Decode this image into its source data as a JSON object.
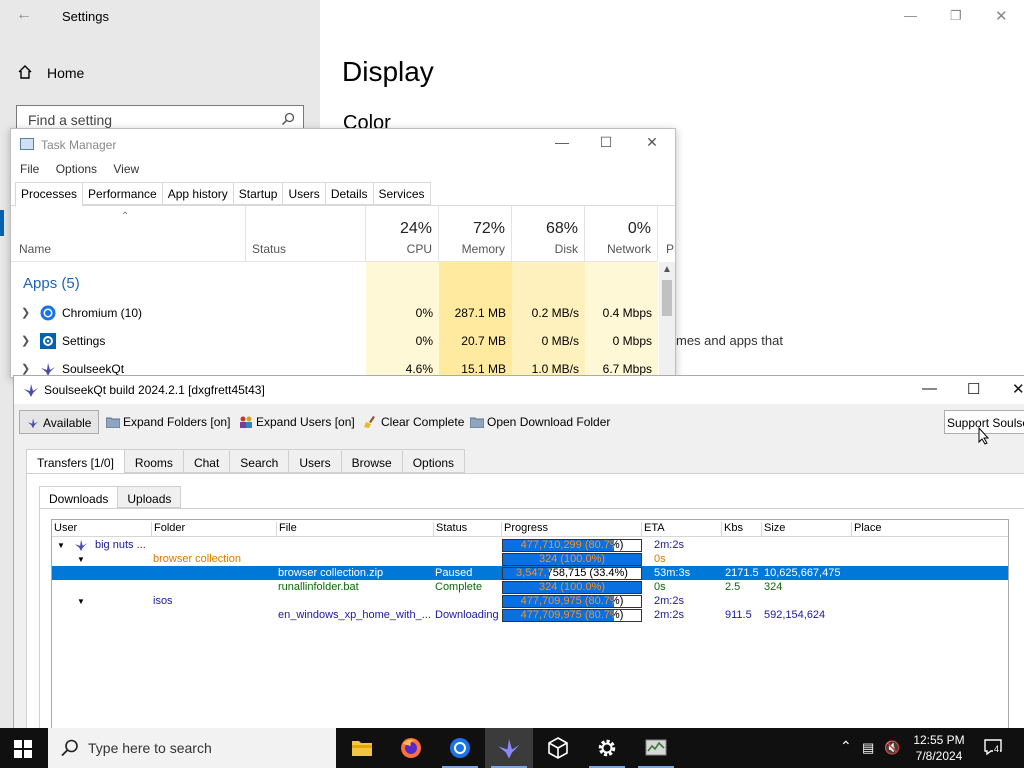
{
  "settings": {
    "title": "Settings",
    "home_label": "Home",
    "search_placeholder": "Find a setting",
    "page_title": "Display",
    "section_title": "Color",
    "snippet_text": "mes and apps that"
  },
  "task_manager": {
    "title": "Task Manager",
    "menu": [
      "File",
      "Options",
      "View"
    ],
    "tabs": [
      "Processes",
      "Performance",
      "App history",
      "Startup",
      "Users",
      "Details",
      "Services"
    ],
    "active_tab": "Processes",
    "columns": {
      "name": "Name",
      "status": "Status",
      "cpu": {
        "pct": "24%",
        "label": "CPU"
      },
      "memory": {
        "pct": "72%",
        "label": "Memory"
      },
      "disk": {
        "pct": "68%",
        "label": "Disk"
      },
      "network": {
        "pct": "0%",
        "label": "Network"
      },
      "power_partial": "P"
    },
    "group_label": "Apps (5)",
    "rows": [
      {
        "name": "Chromium (10)",
        "cpu": "0%",
        "memory": "287.1 MB",
        "disk": "0.2 MB/s",
        "network": "0.4 Mbps"
      },
      {
        "name": "Settings",
        "cpu": "0%",
        "memory": "20.7 MB",
        "disk": "0 MB/s",
        "network": "0 Mbps"
      },
      {
        "name": "SoulseekQt",
        "cpu": "4.6%",
        "memory": "15.1 MB",
        "disk": "1.0 MB/s",
        "network": "6.7 Mbps"
      }
    ]
  },
  "soulseek": {
    "title": "SoulseekQt build 2024.2.1 [dxgfrett45t43]",
    "toolbar": {
      "available": "Available",
      "expand_folders": "Expand Folders [on]",
      "expand_users": "Expand Users [on]",
      "clear_complete": "Clear Complete",
      "open_download_folder": "Open Download Folder",
      "support": "Support Soulseek"
    },
    "main_tabs": [
      "Transfers [1/0]",
      "Rooms",
      "Chat",
      "Search",
      "Users",
      "Browse",
      "Options"
    ],
    "sub_tabs": [
      "Downloads",
      "Uploads"
    ],
    "columns": [
      "User",
      "Folder",
      "File",
      "Status",
      "Progress",
      "ETA",
      "Kbs",
      "Size",
      "Place"
    ],
    "rows": [
      {
        "kind": "user",
        "user": "big nuts ...",
        "folder": "",
        "file": "",
        "status": "",
        "progress": "477,710,299 (80.7%)",
        "fraction": 0.807,
        "eta": "2m:2s",
        "kbs": "",
        "size": "",
        "color": "blue"
      },
      {
        "kind": "folder",
        "user": "",
        "folder": "browser collection",
        "file": "",
        "status": "",
        "progress": "324 (100.0%)",
        "fraction": 1.0,
        "eta": "0s",
        "kbs": "",
        "size": "",
        "color": "orange"
      },
      {
        "kind": "file",
        "user": "",
        "folder": "",
        "file": "browser collection.zip",
        "status": "Paused",
        "progress": "3,547,758,715 (33.4%)",
        "fraction": 0.334,
        "eta": "53m:3s",
        "kbs": "2171.5",
        "size": "10,625,667,475",
        "color": "selected"
      },
      {
        "kind": "file",
        "user": "",
        "folder": "",
        "file": "runallinfolder.bat",
        "status": "Complete",
        "progress": "324 (100.0%)",
        "fraction": 1.0,
        "eta": "0s",
        "kbs": "2.5",
        "size": "324",
        "color": "green"
      },
      {
        "kind": "folder",
        "user": "",
        "folder": "isos",
        "file": "",
        "status": "",
        "progress": "477,709,975 (80.7%)",
        "fraction": 0.807,
        "eta": "2m:2s",
        "kbs": "",
        "size": "",
        "color": "blue"
      },
      {
        "kind": "file",
        "user": "",
        "folder": "",
        "file": "en_windows_xp_home_with_...",
        "status": "Downloading",
        "progress": "477,709,975 (80.7%)",
        "fraction": 0.807,
        "eta": "2m:2s",
        "kbs": "911.5",
        "size": "592,154,624",
        "color": "blue"
      }
    ]
  },
  "taskbar": {
    "search_placeholder": "Type here to search",
    "time": "12:55 PM",
    "date": "7/8/2024",
    "notification_count": "4"
  }
}
